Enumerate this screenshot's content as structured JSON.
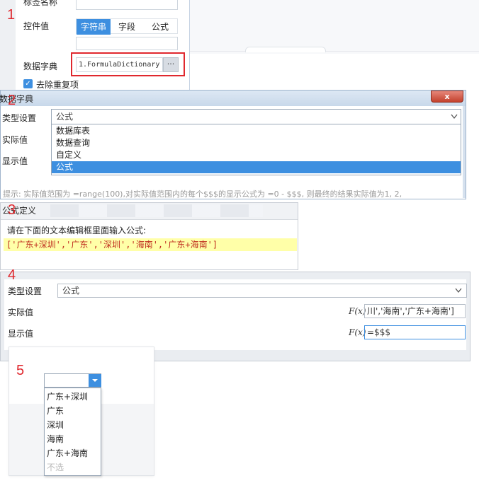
{
  "steps": [
    "1",
    "2",
    "3",
    "4",
    "5"
  ],
  "panel1": {
    "label_name": "标签名称",
    "label_control_value": "控件值",
    "segments": [
      "字符串",
      "字段",
      "公式"
    ],
    "label_dictionary": "数据字典",
    "dictionary_value": "1.FormulaDictionary",
    "more_button": "···",
    "dedupe_label": "去除重复项",
    "dedupe_checked": true
  },
  "panel2": {
    "title": "数据字典",
    "close": "x",
    "type_label": "类型设置",
    "type_value": "公式",
    "actual_label": "实际值",
    "display_label": "显示值",
    "options": [
      "数据库表",
      "数据查询",
      "自定义",
      "公式"
    ],
    "selected_option": "公式",
    "hint": "提示: 实际值范围为 =range(100),对实际值范围内的每个$$$的显示公式为 =0 - $$$, 则最终的结果实际值为1, 2,"
  },
  "panel3": {
    "header": "公式定义",
    "instruction": "请在下面的文本编辑框里面输入公式:",
    "formula": "['广东+深圳','广东','深圳','海南','广东+海南']"
  },
  "panel4": {
    "type_label": "类型设置",
    "type_value": "公式",
    "actual_label": "实际值",
    "actual_value": "川','海南','广东+海南']",
    "display_label": "显示值",
    "display_value": "=$$$",
    "fx_label": "F(x)"
  },
  "panel5": {
    "options": [
      "广东+深圳",
      "广东",
      "深圳",
      "海南",
      "广东+海南"
    ],
    "none_option": "不选"
  },
  "colors": {
    "accent": "#3d8fe0",
    "highlight_red": "#e0282e",
    "formula_bg": "#ffffa8"
  }
}
